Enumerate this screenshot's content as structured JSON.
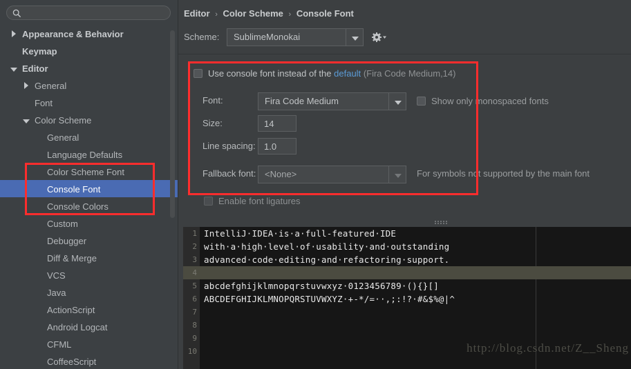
{
  "search": {
    "placeholder": "",
    "value": "",
    "icon": "search-icon"
  },
  "sidebar": {
    "items": [
      {
        "label": "Appearance & Behavior",
        "indent": 0,
        "twisty": "right",
        "bold": true,
        "selected": false
      },
      {
        "label": "Keymap",
        "indent": 0,
        "twisty": "none",
        "bold": true,
        "selected": false
      },
      {
        "label": "Editor",
        "indent": 0,
        "twisty": "down",
        "bold": true,
        "selected": false
      },
      {
        "label": "General",
        "indent": 1,
        "twisty": "right",
        "bold": false,
        "selected": false
      },
      {
        "label": "Font",
        "indent": 1,
        "twisty": "none",
        "bold": false,
        "selected": false
      },
      {
        "label": "Color Scheme",
        "indent": 1,
        "twisty": "down",
        "bold": false,
        "selected": false
      },
      {
        "label": "General",
        "indent": 2,
        "twisty": "none",
        "bold": false,
        "selected": false
      },
      {
        "label": "Language Defaults",
        "indent": 2,
        "twisty": "none",
        "bold": false,
        "selected": false
      },
      {
        "label": "Color Scheme Font",
        "indent": 2,
        "twisty": "none",
        "bold": false,
        "selected": false
      },
      {
        "label": "Console Font",
        "indent": 2,
        "twisty": "none",
        "bold": false,
        "selected": true
      },
      {
        "label": "Console Colors",
        "indent": 2,
        "twisty": "none",
        "bold": false,
        "selected": false
      },
      {
        "label": "Custom",
        "indent": 2,
        "twisty": "none",
        "bold": false,
        "selected": false
      },
      {
        "label": "Debugger",
        "indent": 2,
        "twisty": "none",
        "bold": false,
        "selected": false
      },
      {
        "label": "Diff & Merge",
        "indent": 2,
        "twisty": "none",
        "bold": false,
        "selected": false
      },
      {
        "label": "VCS",
        "indent": 2,
        "twisty": "none",
        "bold": false,
        "selected": false
      },
      {
        "label": "Java",
        "indent": 2,
        "twisty": "none",
        "bold": false,
        "selected": false
      },
      {
        "label": "ActionScript",
        "indent": 2,
        "twisty": "none",
        "bold": false,
        "selected": false
      },
      {
        "label": "Android Logcat",
        "indent": 2,
        "twisty": "none",
        "bold": false,
        "selected": false
      },
      {
        "label": "CFML",
        "indent": 2,
        "twisty": "none",
        "bold": false,
        "selected": false
      },
      {
        "label": "CoffeeScript",
        "indent": 2,
        "twisty": "none",
        "bold": false,
        "selected": false
      }
    ]
  },
  "breadcrumb": {
    "part1": "Editor",
    "part2": "Color Scheme",
    "part3": "Console Font",
    "separator": "›"
  },
  "scheme": {
    "label": "Scheme:",
    "value": "SublimeMonokai",
    "gear_icon": "gear-icon"
  },
  "settings": {
    "use_console_font": {
      "checked": false,
      "text_before": "Use console font instead of the",
      "link": "default",
      "text_after": "(Fira Code Medium,14)"
    },
    "font_label": "Font:",
    "font_value": "Fira Code Medium",
    "show_mono_label": "Show only monospaced fonts",
    "show_mono_checked": false,
    "size_label": "Size:",
    "size_value": "14",
    "line_spacing_label": "Line spacing:",
    "line_spacing_value": "1.0",
    "fallback_label": "Fallback font:",
    "fallback_value": "<None>",
    "fallback_hint": "For symbols not supported by the main font",
    "ligatures_label": "Enable font ligatures",
    "ligatures_checked": false
  },
  "preview": {
    "lines": [
      {
        "n": "1",
        "text": "IntelliJ·IDEA·is·a·full-featured·IDE",
        "current": false
      },
      {
        "n": "2",
        "text": "with·a·high·level·of·usability·and·outstanding",
        "current": false
      },
      {
        "n": "3",
        "text": "advanced·code·editing·and·refactoring·support.",
        "current": false
      },
      {
        "n": "4",
        "text": "",
        "current": true
      },
      {
        "n": "5",
        "text": "abcdefghijklmnopqrstuvwxyz·0123456789·(){}[]",
        "current": false
      },
      {
        "n": "6",
        "text": "ABCDEFGHIJKLMNOPQRSTUVWXYZ·+-*/=··,;:!?·#&$%@|^",
        "current": false
      },
      {
        "n": "7",
        "text": "",
        "current": false
      },
      {
        "n": "8",
        "text": "",
        "current": false
      },
      {
        "n": "9",
        "text": "",
        "current": false
      },
      {
        "n": "10",
        "text": "",
        "current": false
      }
    ]
  },
  "watermark": "http://blog.csdn.net/Z__Sheng",
  "colors": {
    "selection_blue": "#4a6bb3",
    "annotation_red": "#ff2d2d",
    "link_blue": "#5b9bd5",
    "panel_bg": "#3c3f41",
    "editor_bg": "#161616"
  }
}
